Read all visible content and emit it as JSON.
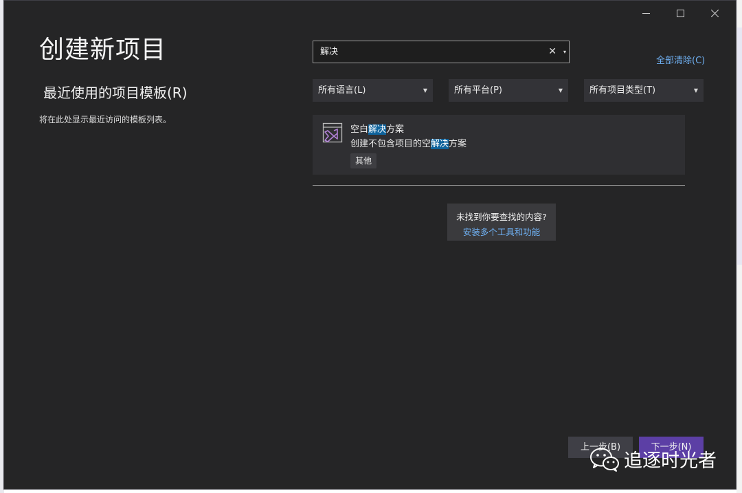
{
  "window": {
    "title": "创建新项目",
    "controls": [
      "minimize-icon",
      "maximize-icon",
      "close-icon"
    ]
  },
  "recent": {
    "heading": "最近使用的项目模板(R)",
    "empty_text": "将在此处显示最近访问的模板列表。"
  },
  "search": {
    "value": "解决",
    "clear_glyph": "✕",
    "dropdown_glyph": "▾"
  },
  "clear_all_label": "全部清除(C)",
  "filters": [
    {
      "label": "所有语言(L)"
    },
    {
      "label": "所有平台(P)"
    },
    {
      "label": "所有项目类型(T)"
    }
  ],
  "results": [
    {
      "icon": "visual-studio-solution-icon",
      "title_before": "空白",
      "title_highlight": "解决",
      "title_after": "方案",
      "desc_before": "创建不包含项目的空",
      "desc_highlight": "解决",
      "desc_after": "方案",
      "tag": "其他"
    }
  ],
  "not_found": {
    "question": "未找到你要查找的内容?",
    "link": "安装多个工具和功能"
  },
  "buttons": {
    "back": "上一步(B)",
    "next": "下一步(N)"
  },
  "watermark": {
    "text": "追逐时光者",
    "icon": "wechat-icon"
  },
  "colors": {
    "background": "#252526",
    "accent": "#5c3fa5",
    "link": "#6fb0f2",
    "highlight": "#0e639c"
  }
}
